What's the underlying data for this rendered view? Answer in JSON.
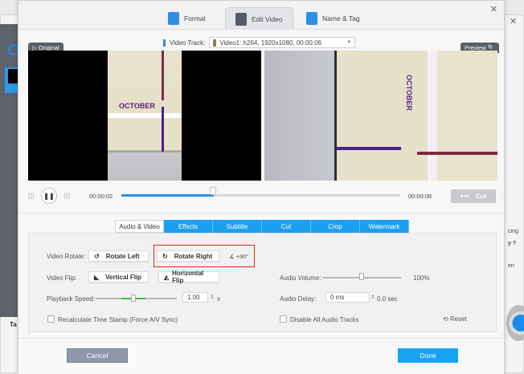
{
  "background_app": {
    "tab_label": "Ta",
    "right_text_1": "cing",
    "right_text_2": "y ?",
    "right_text_3": "en"
  },
  "dialog": {
    "tabs": [
      {
        "label": "Format"
      },
      {
        "label": "Edit Video",
        "active": true
      },
      {
        "label": "Name & Tag"
      }
    ],
    "close_icon": "close-icon",
    "video_track": {
      "label": "Video Track:",
      "value": "Video1: h264, 1920x1080, 00:00:06"
    },
    "original_label": "Original",
    "preview_label": "Preview",
    "player": {
      "current_time": "00:00:02",
      "total_time": "00:00:06",
      "progress_percent": 33,
      "cut_label": "Cut"
    },
    "subtabs": [
      {
        "label": "Audio & Video",
        "active": true
      },
      {
        "label": "Effects"
      },
      {
        "label": "Subtitle"
      },
      {
        "label": "Cut"
      },
      {
        "label": "Crop"
      },
      {
        "label": "Watermark"
      }
    ],
    "audio_video": {
      "video_rotate_label": "Video Rotate:",
      "rotate_left": "Rotate Left",
      "rotate_right": "Rotate Right",
      "rotation_value": "+90°",
      "video_flip_label": "Video Flip:",
      "vertical_flip": "Vertical Flip",
      "horizontal_flip": "Horizontal Flip",
      "playback_speed_label": "Playback Speed:",
      "playback_speed": "1.00",
      "speed_unit": "x",
      "audio_volume_label": "Audio Volume:",
      "audio_volume": "100%",
      "audio_volume_fraction": 0.5,
      "audio_delay_label": "Audio Delay:",
      "audio_delay": "0 ms",
      "audio_delay_sec": "0.0 sec",
      "recalc_label": "Recalculate Time Stamp (Force A/V Sync)",
      "disable_audio_label": "Disable All Audio Tracks",
      "reset_label": "Reset"
    },
    "cancel_label": "Cancel",
    "done_label": "Done",
    "colors": {
      "accent": "#17a3f3",
      "highlight": "#e02424"
    }
  }
}
